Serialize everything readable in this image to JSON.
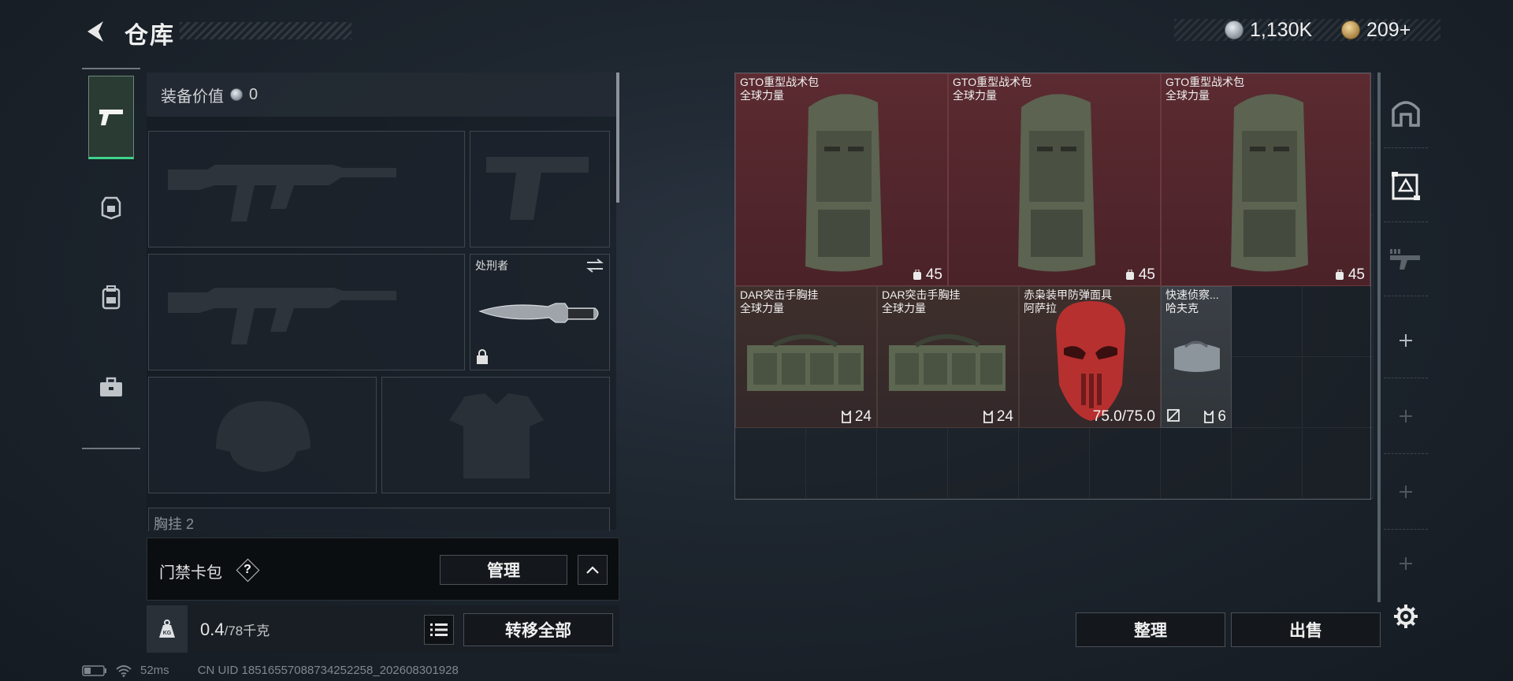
{
  "header": {
    "title": "仓库",
    "currencies": [
      {
        "icon": "silver-coin-icon",
        "value": "1,130K"
      },
      {
        "icon": "gold-coin-icon",
        "value": "209+"
      }
    ]
  },
  "rail": {
    "items": [
      {
        "icon": "pistol-icon",
        "active": true
      },
      {
        "icon": "helmet-armor-icon",
        "active": false
      },
      {
        "icon": "backpack-icon",
        "active": false
      },
      {
        "icon": "briefcase-icon",
        "active": false
      }
    ]
  },
  "equipment": {
    "value_label": "装备价值",
    "value": "0",
    "melee_name": "处刑者",
    "chest_partial_label": "胸挂",
    "chest_partial_count": "2"
  },
  "card_bag": {
    "label": "门禁卡包",
    "help": "?",
    "manage_label": "管理"
  },
  "weight": {
    "current": "0.4",
    "max": "/78千克",
    "transfer_all_label": "转移全部"
  },
  "status": {
    "ping": "52ms",
    "uid": "CN UID 1851655708873425225​8_202608301928"
  },
  "stash": {
    "items": [
      {
        "name": "GTO重型战术包\n全球力量",
        "qty": "45",
        "type": "backpack"
      },
      {
        "name": "GTO重型战术包\n全球力量",
        "qty": "45",
        "type": "backpack"
      },
      {
        "name": "GTO重型战术包\n全球力量",
        "qty": "45",
        "type": "backpack"
      },
      {
        "name": "DAR突击手胸挂\n全球力量",
        "qty": "24",
        "type": "chest_rig"
      },
      {
        "name": "DAR突击手胸挂\n全球力量",
        "qty": "24",
        "type": "chest_rig"
      },
      {
        "name": "赤枭装甲防弹面具\n阿萨拉",
        "durability": "75.0/75.0",
        "type": "mask"
      },
      {
        "name": "快速侦察...\n哈夫克",
        "qty": "6",
        "type": "small_bag"
      }
    ]
  },
  "actions": {
    "sort_label": "整理",
    "sell_label": "出售"
  }
}
